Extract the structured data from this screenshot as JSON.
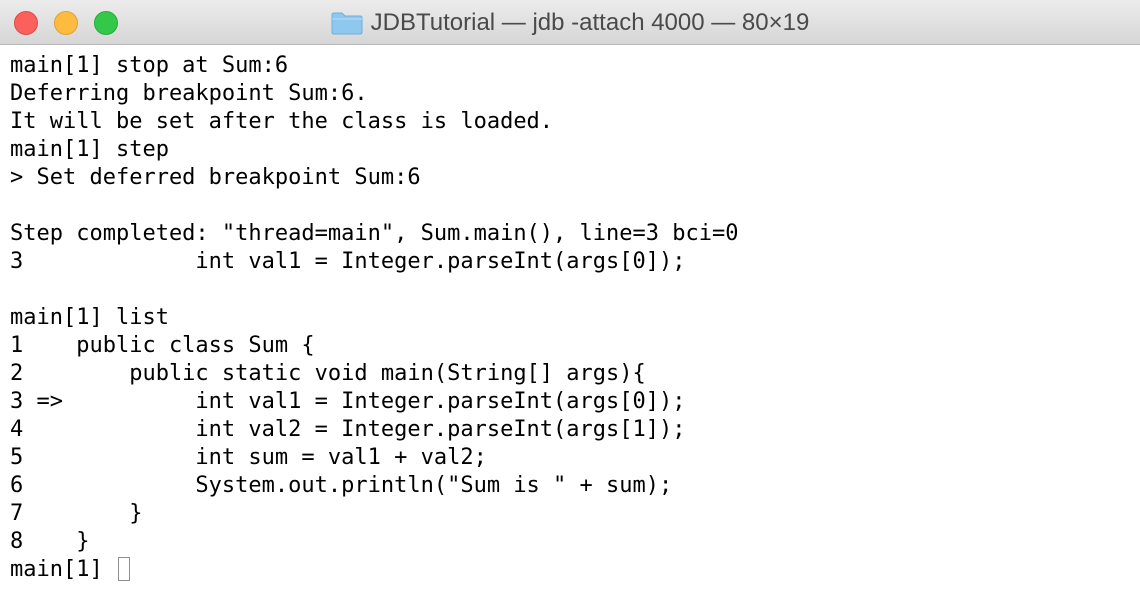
{
  "window": {
    "title": "JDBTutorial — jdb -attach 4000 — 80×19",
    "folder_icon": "folder-icon",
    "close_icon": "close-icon",
    "minimize_icon": "minimize-icon",
    "zoom_icon": "zoom-icon",
    "colors": {
      "close": "#fc605c",
      "minimize": "#fdbc40",
      "zoom": "#34c84a",
      "folder": "#8fc8ef"
    }
  },
  "terminal": {
    "lines": [
      "main[1] stop at Sum:6",
      "Deferring breakpoint Sum:6.",
      "It will be set after the class is loaded.",
      "main[1] step",
      "> Set deferred breakpoint Sum:6",
      "",
      "Step completed: \"thread=main\", Sum.main(), line=3 bci=0",
      "3             int val1 = Integer.parseInt(args[0]);",
      "",
      "main[1] list",
      "1    public class Sum {",
      "2        public static void main(String[] args){",
      "3 =>          int val1 = Integer.parseInt(args[0]);",
      "4             int val2 = Integer.parseInt(args[1]);",
      "5             int sum = val1 + val2;",
      "6             System.out.println(\"Sum is \" + sum);",
      "7        }",
      "8    }"
    ],
    "prompt": "main[1] ",
    "cursor_icon": "cursor-block-icon"
  }
}
